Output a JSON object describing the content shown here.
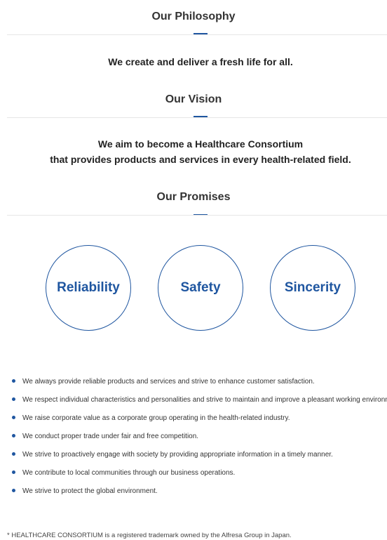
{
  "philosophy": {
    "title": "Our Philosophy",
    "statement": "We create and deliver a fresh life for all."
  },
  "vision": {
    "title": "Our Vision",
    "statement_line1": "We aim to become a Healthcare Consortium",
    "statement_line2": "that provides products and services in every health-related field."
  },
  "promises": {
    "title": "Our Promises",
    "circles": [
      "Reliability",
      "Safety",
      "Sincerity"
    ],
    "items": [
      "We always provide reliable products and services and strive to enhance customer satisfaction.",
      "We respect individual characteristics and personalities and strive to maintain and improve a pleasant working environment.",
      "We raise corporate value as a corporate group operating in the health-related industry.",
      "We conduct proper trade under fair and free competition.",
      "We strive to proactively engage with society by providing appropriate information in a timely manner.",
      "We contribute to local communities through our business operations.",
      "We strive to protect the global environment."
    ]
  },
  "footnote": "* HEALTHCARE CONSORTIUM is a registered trademark owned by the Alfresa Group in Japan.",
  "colors": {
    "accent": "#1f56a0",
    "rule": "#e6e6e6"
  }
}
